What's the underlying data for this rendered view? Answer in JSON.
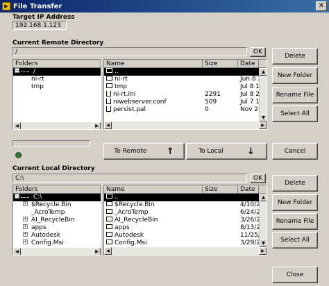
{
  "window": {
    "title": "File Transfer",
    "close_glyph": "✕"
  },
  "target": {
    "label": "Target IP Address",
    "value": "192.168.1.123"
  },
  "remote": {
    "label": "Current Remote Directory",
    "path": "/",
    "ok": "OK",
    "folders_header": "Folders",
    "tree": [
      {
        "label": "/",
        "selected": true
      },
      {
        "label": "ni-rt"
      },
      {
        "label": "tmp"
      }
    ],
    "columns": [
      "Name",
      "Size",
      "Date"
    ],
    "files": [
      {
        "name": "..",
        "size": "",
        "date": "",
        "selected": true,
        "open": true
      },
      {
        "name": "ni-rt",
        "size": "",
        "date": "Jun 8 20"
      },
      {
        "name": "tmp",
        "size": "",
        "date": "Jul 8 16"
      },
      {
        "name": "ni-rt.ini",
        "size": "2291",
        "date": "Jul 8 21"
      },
      {
        "name": "niwebserver.conf",
        "size": "509",
        "date": "Jul 7 15"
      },
      {
        "name": "persist.pal",
        "size": "0",
        "date": "Nov 21"
      }
    ]
  },
  "buttons": {
    "delete": "Delete",
    "new_folder": "New Folder",
    "rename": "Rename File",
    "select_all": "Select All",
    "to_remote": "To Remote",
    "to_local": "To Local",
    "cancel": "Cancel",
    "close": "Close",
    "up_arrow": "↑",
    "down_arrow": "↓"
  },
  "progress": 0,
  "local": {
    "label": "Current Local Directory",
    "path": "C:\\",
    "ok": "OK",
    "folders_header": "Folders",
    "tree": [
      {
        "label": "C:\\",
        "selected": true
      },
      {
        "label": "$Recycle.Bin",
        "expand": true
      },
      {
        "label": "_AcroTemp",
        "expand": false
      },
      {
        "label": "AI_RecycleBin",
        "expand": true
      },
      {
        "label": "apps",
        "expand": true
      },
      {
        "label": "Autodesk",
        "expand": true
      },
      {
        "label": "Config.Msi",
        "expand": true
      }
    ],
    "columns": [
      "Name",
      "Size",
      "Date"
    ],
    "files": [
      {
        "name": "..",
        "size": "",
        "date": "",
        "selected": true,
        "open": true
      },
      {
        "name": "$Recycle.Bin",
        "size": "",
        "date": "4/10/20"
      },
      {
        "name": "_AcroTemp",
        "size": "",
        "date": "6/24/20"
      },
      {
        "name": "AI_RecycleBin",
        "size": "",
        "date": "3/26/20"
      },
      {
        "name": "apps",
        "size": "",
        "date": "8/13/20"
      },
      {
        "name": "Autodesk",
        "size": "",
        "date": "11/25/2"
      },
      {
        "name": "Config.Msi",
        "size": "",
        "date": "3/29/20"
      }
    ]
  },
  "colors": {
    "title_start": "#0a246a",
    "title_end": "#3a6ea5",
    "led": "#2e7d2e"
  }
}
